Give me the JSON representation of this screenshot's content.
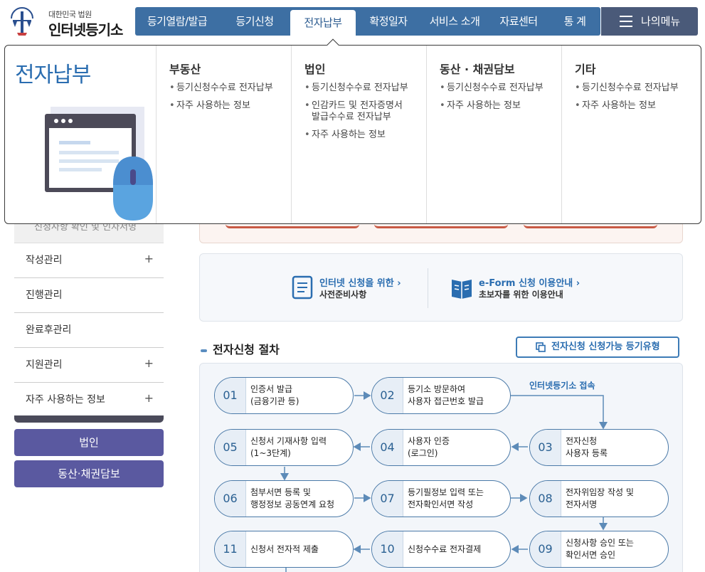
{
  "header": {
    "logo_small": "대한민국 법원",
    "logo_big": "인터넷등기소",
    "gnb": [
      {
        "label": "등기열람/발급"
      },
      {
        "label": "등기신청"
      },
      {
        "label": "전자납부"
      },
      {
        "label": "확정일자"
      },
      {
        "label": "서비스 소개"
      },
      {
        "label": "자료센터"
      },
      {
        "label": "통 계"
      }
    ],
    "active_tab": "전자납부",
    "mymenu": "나의메뉴"
  },
  "mega_menu": {
    "title": "전자납부",
    "columns": [
      {
        "heading": "부동산",
        "items": [
          "등기신청수수료 전자납부",
          "자주 사용하는 정보"
        ]
      },
      {
        "heading": "법인",
        "items": [
          "등기신청수수료 전자납부",
          "인감카드 및 전자증명서\n발급수수료 전자납부",
          "자주 사용하는 정보"
        ]
      },
      {
        "heading": "동산 · 채권담보",
        "items": [
          "등기신청수수료 전자납부",
          "자주 사용하는 정보"
        ]
      },
      {
        "heading": "기타",
        "items": [
          "등기신청수수료 전자납부",
          "자주 사용하는 정보"
        ]
      }
    ]
  },
  "sidebar": {
    "partial_item": "신청사항 확인 및 인자서명",
    "items": [
      {
        "label": "작성관리",
        "plus": "+"
      },
      {
        "label": "진행관리",
        "plus": ""
      },
      {
        "label": "완료후관리",
        "plus": ""
      },
      {
        "label": "지원관리",
        "plus": "+"
      },
      {
        "label": "자주 사용하는 정보",
        "plus": "+"
      }
    ],
    "buttons": [
      "법인",
      "동산·채권담보"
    ]
  },
  "info_links": [
    {
      "title": "인터넷 신청을 위한 ›",
      "sub": "사전준비사항",
      "icon": "document-icon"
    },
    {
      "title": "e-Form 신청 이용안내 ›",
      "sub": "초보자를 위한 이용안내",
      "icon": "book-icon"
    }
  ],
  "section": {
    "title": "전자신청 절차",
    "type_button": "전자신청 신청가능 등기유형"
  },
  "process": {
    "note": "인터넷등기소 접속",
    "steps": [
      {
        "num": "01",
        "lines": [
          "인증서 발급",
          "(금융기관 등)"
        ]
      },
      {
        "num": "02",
        "lines": [
          "등기소 방문하여",
          "사용자 접근번호 발급"
        ]
      },
      {
        "num": "03",
        "lines": [
          "전자신청",
          "사용자 등록"
        ]
      },
      {
        "num": "04",
        "lines": [
          "사용자 인증",
          "(로그인)"
        ]
      },
      {
        "num": "05",
        "lines": [
          "신청서 기재사항 입력",
          "(1~3단계)"
        ]
      },
      {
        "num": "06",
        "lines": [
          "첨부서면 등록 및",
          "행정정보 공동연계 요청"
        ]
      },
      {
        "num": "07",
        "lines": [
          "등기필정보 입력 또는",
          "전자확인서면 작성"
        ]
      },
      {
        "num": "08",
        "lines": [
          "전자위임장 작성 및",
          "전자서명"
        ]
      },
      {
        "num": "09",
        "lines": [
          "신청사항 승인 또는",
          "확인서면 승인"
        ]
      },
      {
        "num": "10",
        "lines": [
          "신청수수료 전자결제"
        ]
      },
      {
        "num": "11",
        "lines": [
          "신청서 전자적 제출"
        ]
      }
    ]
  },
  "colors": {
    "primary": "#3d6fa3",
    "mymenu": "#4a5a79",
    "sidebar_button": "#5a59a0",
    "accent_text": "#2a6db0"
  }
}
